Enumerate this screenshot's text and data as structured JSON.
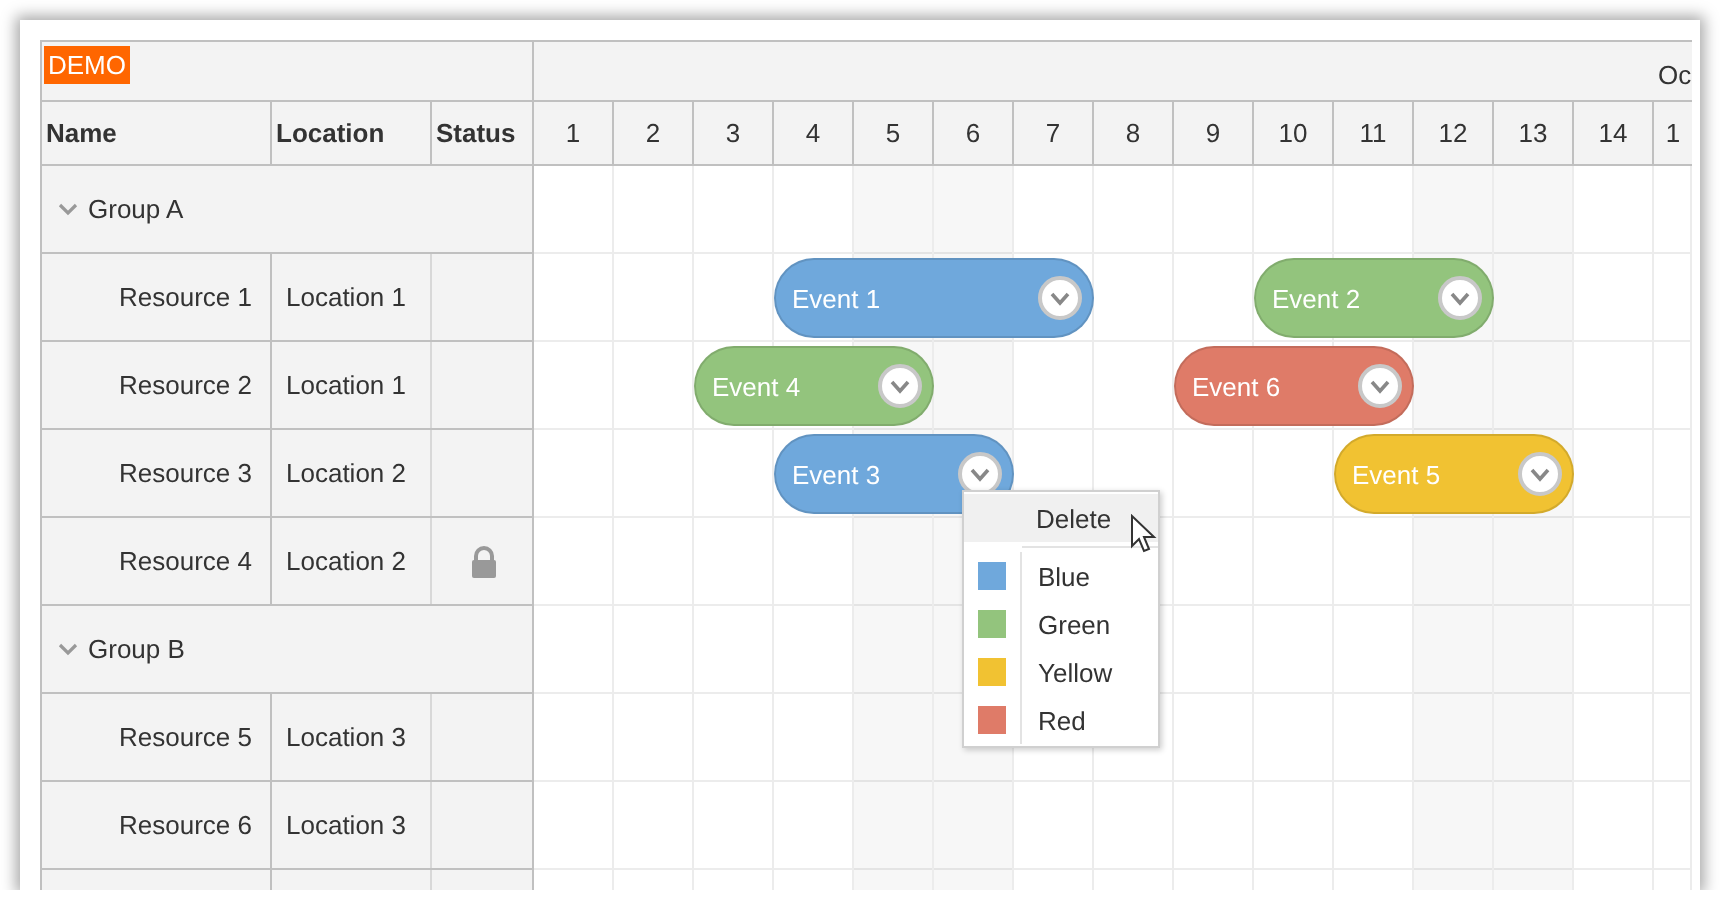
{
  "badge": "DEMO",
  "month": "Oc",
  "columns": [
    {
      "label": "Name"
    },
    {
      "label": "Location"
    },
    {
      "label": "Status"
    }
  ],
  "days": [
    {
      "label": "1",
      "weekend": false
    },
    {
      "label": "2",
      "weekend": false
    },
    {
      "label": "3",
      "weekend": false
    },
    {
      "label": "4",
      "weekend": false
    },
    {
      "label": "5",
      "weekend": true
    },
    {
      "label": "6",
      "weekend": true
    },
    {
      "label": "7",
      "weekend": false
    },
    {
      "label": "8",
      "weekend": false
    },
    {
      "label": "9",
      "weekend": false
    },
    {
      "label": "10",
      "weekend": false
    },
    {
      "label": "11",
      "weekend": false
    },
    {
      "label": "12",
      "weekend": true
    },
    {
      "label": "13",
      "weekend": true
    },
    {
      "label": "14",
      "weekend": false
    },
    {
      "label": "1",
      "weekend": false
    }
  ],
  "groups": [
    {
      "name": "Group A",
      "expanded": true,
      "resources": [
        {
          "name": "Resource 1",
          "location": "Location 1",
          "locked": false,
          "track": [
            {
              "kind": "gap"
            },
            {
              "kind": "gap"
            },
            {
              "kind": "gap"
            },
            {
              "kind": "event",
              "text": "Event 1",
              "color": "#6fa8dc"
            },
            {
              "kind": "more"
            },
            {
              "kind": "more"
            },
            {
              "kind": "more"
            },
            {
              "kind": "gap"
            },
            {
              "kind": "gap"
            },
            {
              "kind": "event",
              "text": "Event 2",
              "color": "#93c47d"
            },
            {
              "kind": "more"
            },
            {
              "kind": "more"
            }
          ]
        },
        {
          "name": "Resource 2",
          "location": "Location 1",
          "locked": false,
          "track": [
            {
              "kind": "gap"
            },
            {
              "kind": "gap"
            },
            {
              "kind": "event",
              "text": "Event 4",
              "color": "#93c47d"
            },
            {
              "kind": "more"
            },
            {
              "kind": "more"
            },
            {
              "kind": "gap"
            },
            {
              "kind": "gap"
            },
            {
              "kind": "gap"
            },
            {
              "kind": "event",
              "text": "Event 6",
              "color": "#df7b68"
            },
            {
              "kind": "more"
            },
            {
              "kind": "more"
            }
          ]
        },
        {
          "name": "Resource 3",
          "location": "Location 2",
          "locked": false,
          "track": [
            {
              "kind": "gap"
            },
            {
              "kind": "gap"
            },
            {
              "kind": "gap"
            },
            {
              "kind": "event",
              "text": "Event 3",
              "color": "#6fa8dc"
            },
            {
              "kind": "more"
            },
            {
              "kind": "more"
            },
            {
              "kind": "gap"
            },
            {
              "kind": "gap"
            },
            {
              "kind": "gap"
            },
            {
              "kind": "gap"
            },
            {
              "kind": "event",
              "text": "Event 5",
              "color": "#f1c232"
            },
            {
              "kind": "more"
            },
            {
              "kind": "more"
            }
          ]
        },
        {
          "name": "Resource 4",
          "location": "Location 2",
          "locked": true
        }
      ]
    },
    {
      "name": "Group B",
      "expanded": true,
      "resources": [
        {
          "name": "Resource 5",
          "location": "Location 3",
          "locked": false
        },
        {
          "name": "Resource 6",
          "location": "Location 3",
          "locked": false
        }
      ]
    }
  ],
  "context_menu": {
    "items": [
      {
        "kind": "action",
        "text": "Delete",
        "highlighted": true
      },
      {
        "kind": "color",
        "text": "Blue",
        "color": "#6fa8dc",
        "highlighted": false
      },
      {
        "kind": "color",
        "text": "Green",
        "color": "#93c47d",
        "highlighted": false
      },
      {
        "kind": "color",
        "text": "Yellow",
        "color": "#f1c232",
        "highlighted": false
      },
      {
        "kind": "color",
        "text": "Red",
        "color": "#df7b68",
        "highlighted": false
      }
    ]
  }
}
